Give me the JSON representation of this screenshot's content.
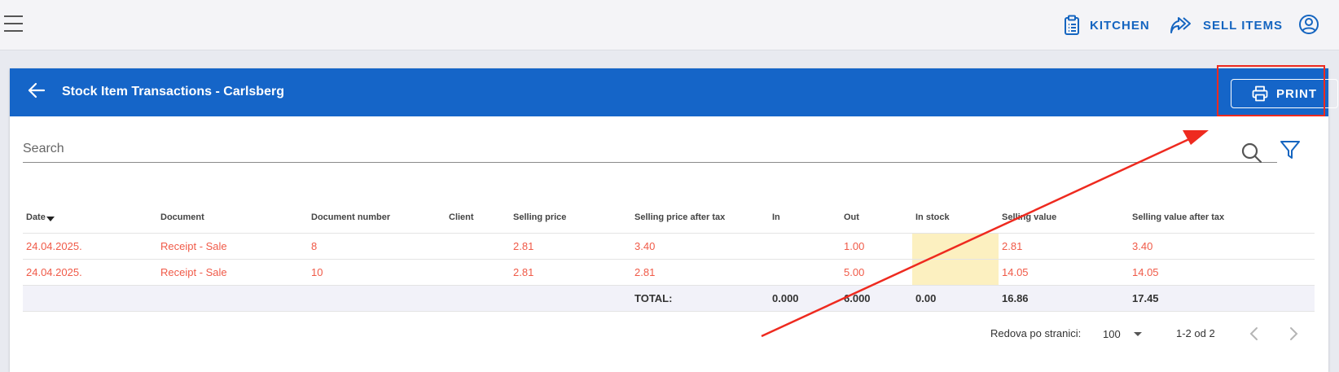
{
  "topbar": {
    "kitchen_label": "KITCHEN",
    "sell_label": "SELL ITEMS"
  },
  "header": {
    "title": "Stock Item Transactions - Carlsberg",
    "print_label": "PRINT"
  },
  "search": {
    "placeholder": "Search"
  },
  "table": {
    "columns": [
      "Date",
      "Document",
      "Document number",
      "Client",
      "Selling price",
      "Selling price after tax",
      "In",
      "Out",
      "In stock",
      "Selling value",
      "Selling value after tax"
    ],
    "rows": [
      [
        "24.04.2025.",
        "Receipt - Sale",
        "8",
        "",
        "2.81",
        "3.40",
        "",
        "1.00",
        "",
        "2.81",
        "3.40"
      ],
      [
        "24.04.2025.",
        "Receipt - Sale",
        "10",
        "",
        "2.81",
        "2.81",
        "",
        "5.00",
        "",
        "14.05",
        "14.05"
      ]
    ],
    "total": {
      "label": "TOTAL:",
      "in": "0.000",
      "out": "6.000",
      "in_stock": "0.00",
      "selling_value": "16.86",
      "selling_value_after_tax": "17.45"
    }
  },
  "pagination": {
    "rows_per_page_label": "Redova po stranici:",
    "rows_per_page": "100",
    "range": "1-2 od 2"
  },
  "colors": {
    "header_blue": "#1565c8",
    "accent_blue": "#1565c0",
    "row_text": "#f05a48",
    "annotation_red": "#ee2a1f",
    "in_stock_highlight": "#fcf0c0"
  }
}
